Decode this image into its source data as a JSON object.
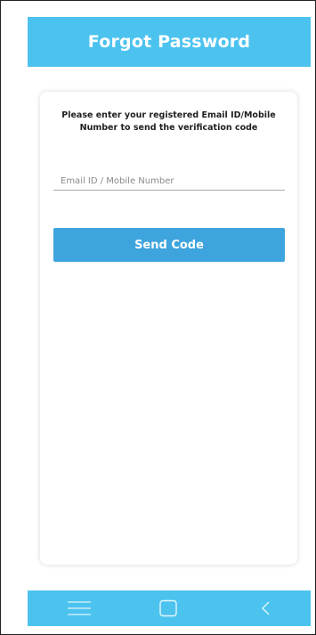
{
  "header": {
    "title": "Forgot Password"
  },
  "form": {
    "instructions": "Please enter your registered Email ID/Mobile Number to send the verification code",
    "contact_field": {
      "placeholder": "Email ID / Mobile Number",
      "value": ""
    },
    "send_button_label": "Send Code"
  },
  "navbar": {
    "icons": [
      "menu-icon",
      "home-square-icon",
      "back-chevron-icon"
    ]
  },
  "colors": {
    "header_bg": "#4cc3ef",
    "button_bg": "#3ea4dd",
    "navbar_bg": "#4cc3ef"
  }
}
